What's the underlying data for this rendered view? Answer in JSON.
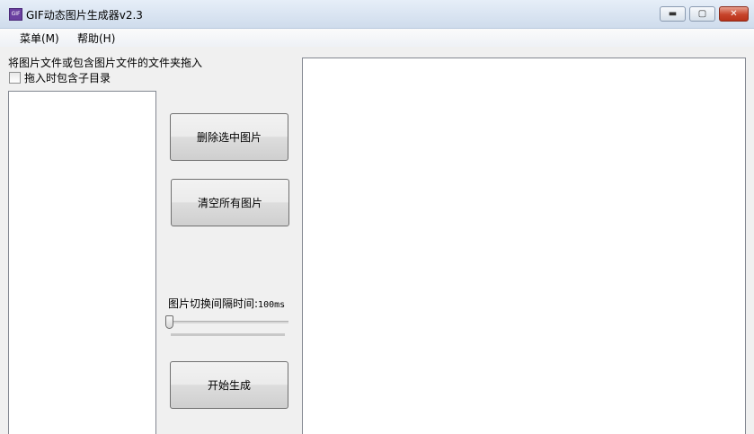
{
  "window": {
    "title": "GIF动态图片生成器v2.3",
    "icon_name": "gif-app-icon",
    "icon_text": "GIF",
    "minimize_glyph": "▬",
    "maximize_glyph": "▢",
    "close_glyph": "✕"
  },
  "menu": {
    "items": [
      {
        "label": "菜单(M)"
      },
      {
        "label": "帮助(H)"
      }
    ]
  },
  "left_panel": {
    "instruction": "将图片文件或包含图片文件的文件夹拖入",
    "include_subdirs": {
      "label": "拖入时包含子目录",
      "checked": false
    }
  },
  "buttons": {
    "delete_selected": "删除选中图片",
    "clear_all": "清空所有图片",
    "start": "开始生成"
  },
  "interval": {
    "label": "图片切换间隔时间:",
    "value_text": "100ms",
    "slider_position": 0
  },
  "colors": {
    "close_button": "#c7432a",
    "app_icon": "#6a3fa0"
  }
}
